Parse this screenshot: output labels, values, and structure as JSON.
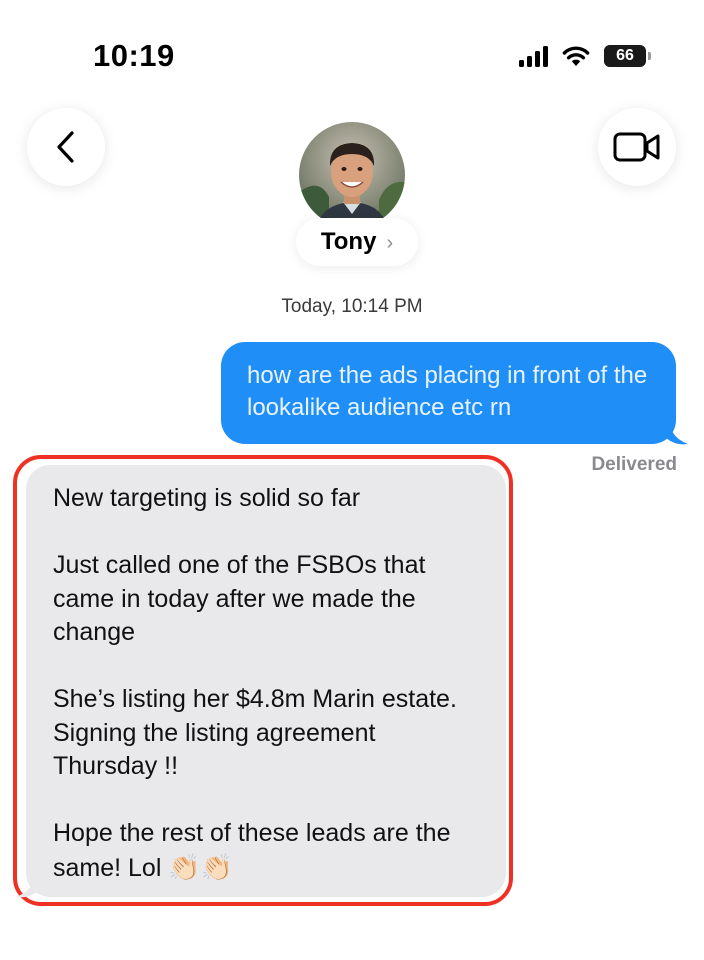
{
  "status_bar": {
    "time": "10:19",
    "battery_level": "66"
  },
  "header": {
    "contact_name": "Tony",
    "chevron": "›",
    "icons": {
      "back": "chevron-left-icon",
      "video": "video-camera-icon"
    }
  },
  "conversation": {
    "timestamp": "Today, 10:14 PM",
    "outgoing_message": "how are the ads placing in front of the lookalike audience etc rn",
    "delivery_status": "Delivered",
    "incoming_message": {
      "paragraphs": [
        "New targeting is solid so far",
        "Just called one of the FSBOs that came in today after we made the change",
        "She’s listing her $4.8m Marin estate. Signing the listing agreement Thursday !!",
        "Hope the rest of these leads are the same! Lol"
      ],
      "emoji": "👏🏻👏🏻"
    }
  },
  "colors": {
    "outgoing_bubble": "#1f8ef7",
    "incoming_bubble": "#e9e9eb",
    "highlight_border": "#ee3124"
  }
}
